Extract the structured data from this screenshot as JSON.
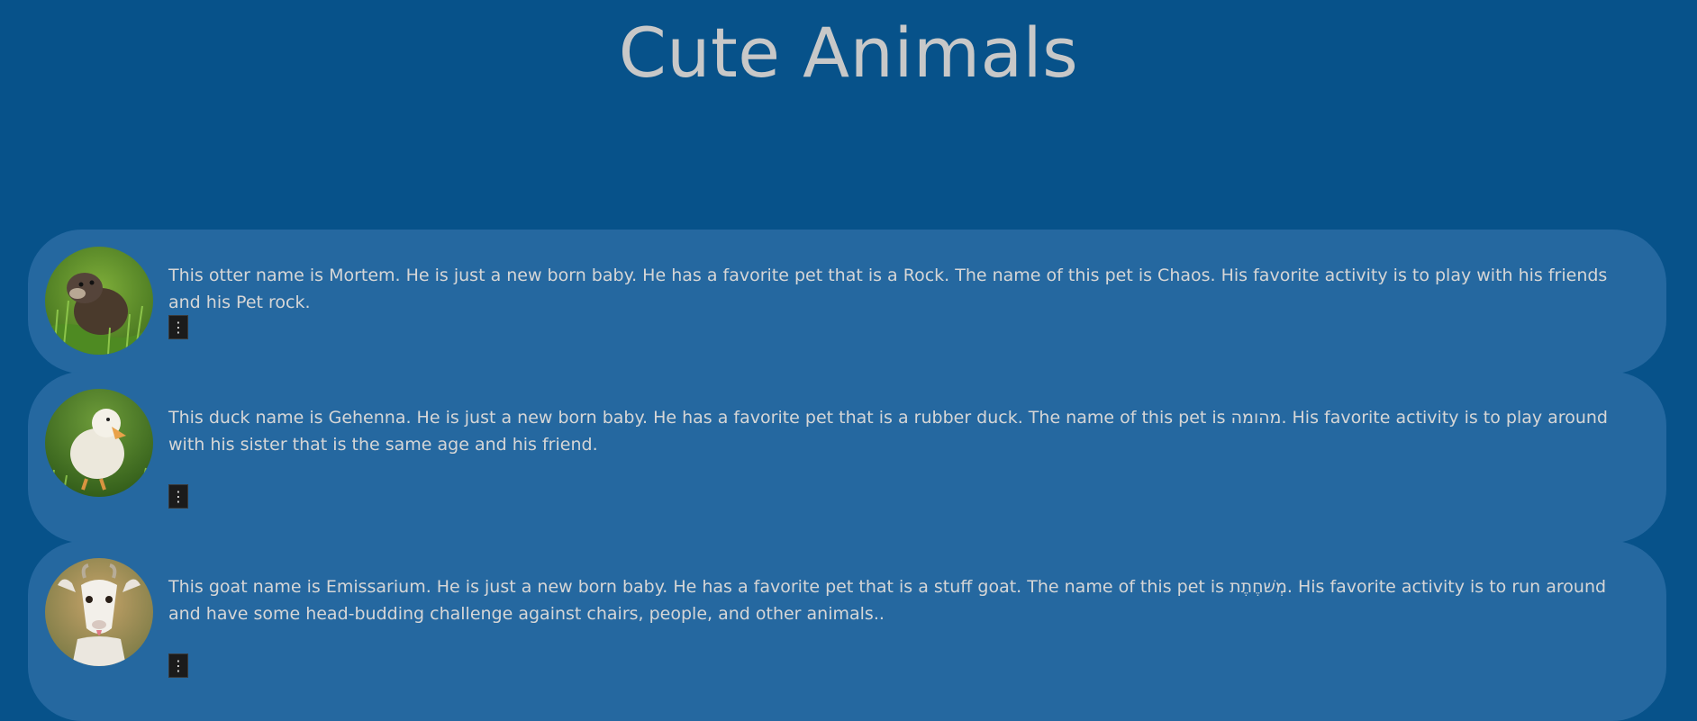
{
  "page": {
    "title": "Cute Animals"
  },
  "cards": [
    {
      "animal": "otter",
      "text": "This otter name is Mortem. He is just a new born baby. He has a favorite pet that is a Rock. The name of this pet is Chaos. His favorite activity is to play with his friends and his Pet rock.",
      "menu_glyph": "⋮"
    },
    {
      "animal": "duck",
      "text": "This duck name is Gehenna. He is just a new born baby. He has a favorite pet that is a rubber duck. The name of this pet is מהומה. His favorite activity is to play around with his sister that is the same age and his friend.",
      "menu_glyph": "⋮"
    },
    {
      "animal": "goat",
      "text": "This goat name is Emissarium. He is just a new born baby. He has a favorite pet that is a stuff goat. The name of this pet is מְשׁחֶתֶת. His favorite activity is to run around and have some head-budding challenge against chairs, people, and other animals..",
      "menu_glyph": "⋮"
    }
  ],
  "colors": {
    "background": "#07528a",
    "card": "#2568a0",
    "title": "#c8c8c8",
    "text": "#d6d6d6",
    "menu_button": "#1b1b1b"
  }
}
